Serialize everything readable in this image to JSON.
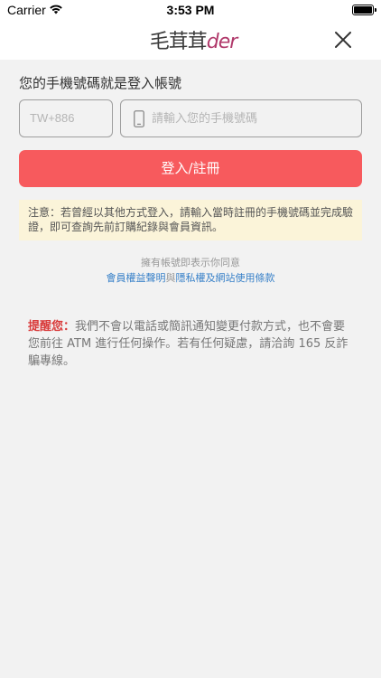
{
  "status_bar": {
    "carrier": "Carrier",
    "time": "3:53 PM",
    "battery_level": 1.0
  },
  "header": {
    "logo_text_main": "毛茸茸",
    "logo_text_accent": "der",
    "close_icon": "close-icon"
  },
  "form": {
    "title": "您的手機號碼就是登入帳號",
    "country_code_placeholder": "TW+886",
    "phone_placeholder": "請輸入您的手機號碼",
    "phone_icon": "mobile-phone-icon",
    "submit_label": "登入/註冊"
  },
  "notice": {
    "text": "注意：若曾經以其他方式登入，請輸入當時註冊的手機號碼並完成驗證，即可查詢先前訂購紀錄與會員資訊。"
  },
  "agreement": {
    "prefix": "擁有帳號即表示你同意",
    "terms_link": "會員權益聲明",
    "connector": "與",
    "privacy_link": "隱私權及網站使用條款"
  },
  "warning": {
    "label": "提醒您：",
    "text": "我們不會以電話或簡訊通知變更付款方式，也不會要您前往 ATM 進行任何操作。若有任何疑慮，請洽詢 165 反詐騙專線。"
  },
  "colors": {
    "primary": "#f75a5d",
    "notice_bg": "#fbf4d9",
    "link": "#3a82c9",
    "warning_label": "#d93a3a",
    "background": "#f2f2f2"
  }
}
